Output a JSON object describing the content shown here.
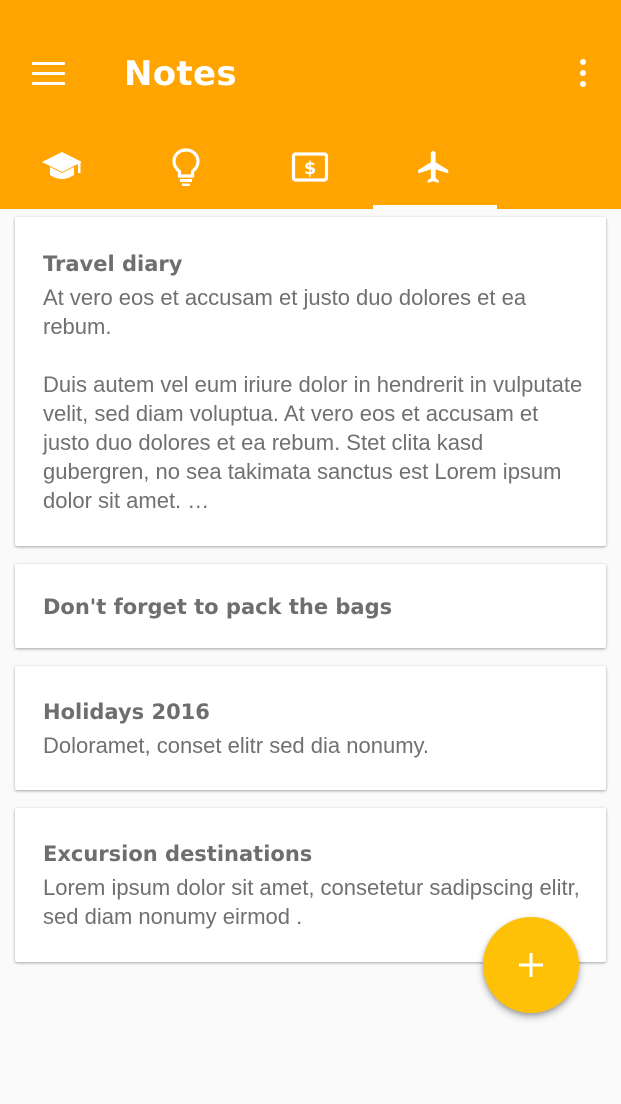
{
  "appbar": {
    "title": "Notes",
    "background": "#ffa400",
    "menu_icon": "menu-icon",
    "more_icon": "more-vert-icon"
  },
  "tabs": [
    {
      "icon": "school-icon",
      "selected": false
    },
    {
      "icon": "lightbulb-icon",
      "selected": false
    },
    {
      "icon": "money-icon",
      "selected": false
    },
    {
      "icon": "flight-icon",
      "selected": true
    }
  ],
  "notes": [
    {
      "title": "Travel diary",
      "body": "At vero eos et accusam et justo duo dolores et ea rebum.\n\nDuis autem vel eum iriure dolor in hendrerit in vulputate velit, sed diam voluptua. At vero eos et accusam et justo duo dolores et ea rebum. Stet clita kasd gubergren, no sea takimata sanctus est Lorem ipsum dolor sit amet. …"
    },
    {
      "title": "Don't forget to pack the bags",
      "body": ""
    },
    {
      "title": "Holidays 2016",
      "body": "Doloramet, conset elitr sed dia nonumy."
    },
    {
      "title": "Excursion destinations",
      "body": "Lorem ipsum dolor sit amet, consetetur sadipscing elitr, sed diam nonumy eirmod ."
    }
  ],
  "fab": {
    "icon": "add-icon",
    "color": "#ffc107"
  }
}
